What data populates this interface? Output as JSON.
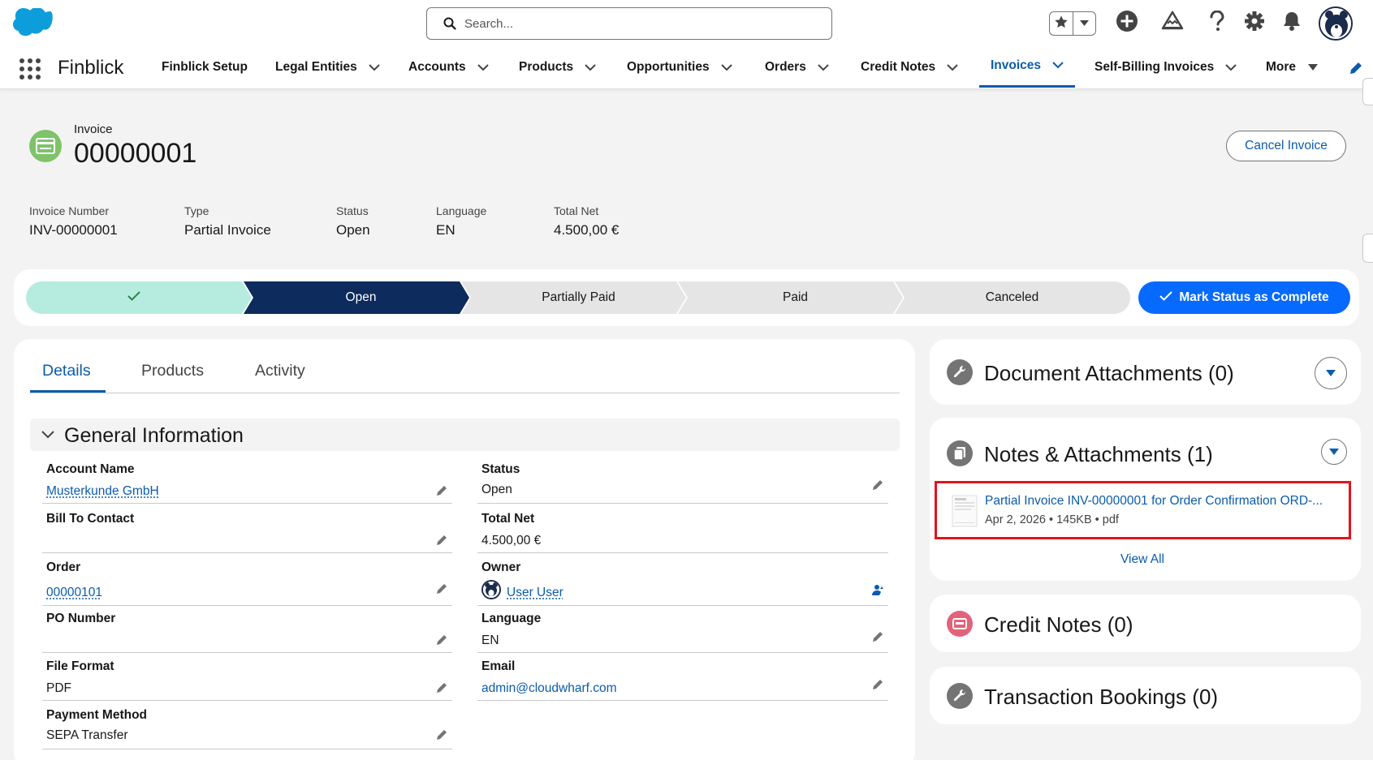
{
  "header": {
    "search_placeholder": "Search..."
  },
  "nav": {
    "app_name": "Finblick",
    "items": [
      {
        "label": "Finblick Setup"
      },
      {
        "label": "Legal Entities"
      },
      {
        "label": "Accounts"
      },
      {
        "label": "Products"
      },
      {
        "label": "Opportunities"
      },
      {
        "label": "Orders"
      },
      {
        "label": "Credit Notes"
      },
      {
        "label": "Invoices"
      },
      {
        "label": "Self-Billing Invoices"
      },
      {
        "label": "More"
      }
    ],
    "active_item": "Invoices"
  },
  "record": {
    "entity_label": "Invoice",
    "title": "00000001",
    "cancel_button": "Cancel Invoice",
    "highlights": [
      {
        "label": "Invoice Number",
        "value": "INV-00000001"
      },
      {
        "label": "Type",
        "value": "Partial Invoice"
      },
      {
        "label": "Status",
        "value": "Open"
      },
      {
        "label": "Language",
        "value": "EN"
      },
      {
        "label": "Total Net",
        "value": "4.500,00 €"
      }
    ]
  },
  "path": {
    "stages": [
      "",
      "Open",
      "Partially Paid",
      "Paid",
      "Canceled"
    ],
    "current_stage": "Open",
    "mark_complete_button": "Mark Status as Complete"
  },
  "details": {
    "tabs": [
      "Details",
      "Products",
      "Activity"
    ],
    "active_tab": "Details",
    "section_title": "General Information",
    "left_fields": [
      {
        "label": "Account Name",
        "value": "Musterkunde GmbH"
      },
      {
        "label": "Bill To Contact",
        "value": ""
      },
      {
        "label": "Order",
        "value": "00000101"
      },
      {
        "label": "PO Number",
        "value": ""
      },
      {
        "label": "File Format",
        "value": "PDF"
      },
      {
        "label": "Payment Method",
        "value": "SEPA Transfer"
      }
    ],
    "right_fields": [
      {
        "label": "Status",
        "value": "Open"
      },
      {
        "label": "Total Net",
        "value": "4.500,00 €"
      },
      {
        "label": "Owner",
        "value": "User User"
      },
      {
        "label": "Language",
        "value": "EN"
      },
      {
        "label": "Email",
        "value": "admin@cloudwharf.com"
      }
    ]
  },
  "sidebar": {
    "document_attachments": "Document Attachments (0)",
    "notes_attachments": "Notes & Attachments (1)",
    "attachment": {
      "title": "Partial Invoice INV-00000001 for Order Confirmation ORD-...",
      "meta": "Apr 2, 2026 • 145KB • pdf"
    },
    "view_all": "View All",
    "credit_notes": "Credit Notes (0)",
    "transaction_bookings": "Transaction Bookings (0)"
  },
  "colors": {
    "brand_blue": "#0b5cab",
    "primary_button": "#066afe",
    "path_complete": "#b6ece0",
    "path_current": "#0d2b5c",
    "path_incomplete": "#e5e5e5",
    "invoice_icon": "#7ec36a",
    "credit_notes_icon": "#e3627b",
    "highlight_border": "#e4131b"
  },
  "icons": [
    "salesforce-cloud-logo",
    "search-icon",
    "star-icon",
    "add-icon",
    "trailhead-icon",
    "help-icon",
    "gear-icon",
    "bell-icon",
    "app-launcher-icon",
    "edit-icon",
    "wrench-icon",
    "copy-icon",
    "check-icon",
    "chevron-down-icon",
    "change-owner-icon"
  ]
}
